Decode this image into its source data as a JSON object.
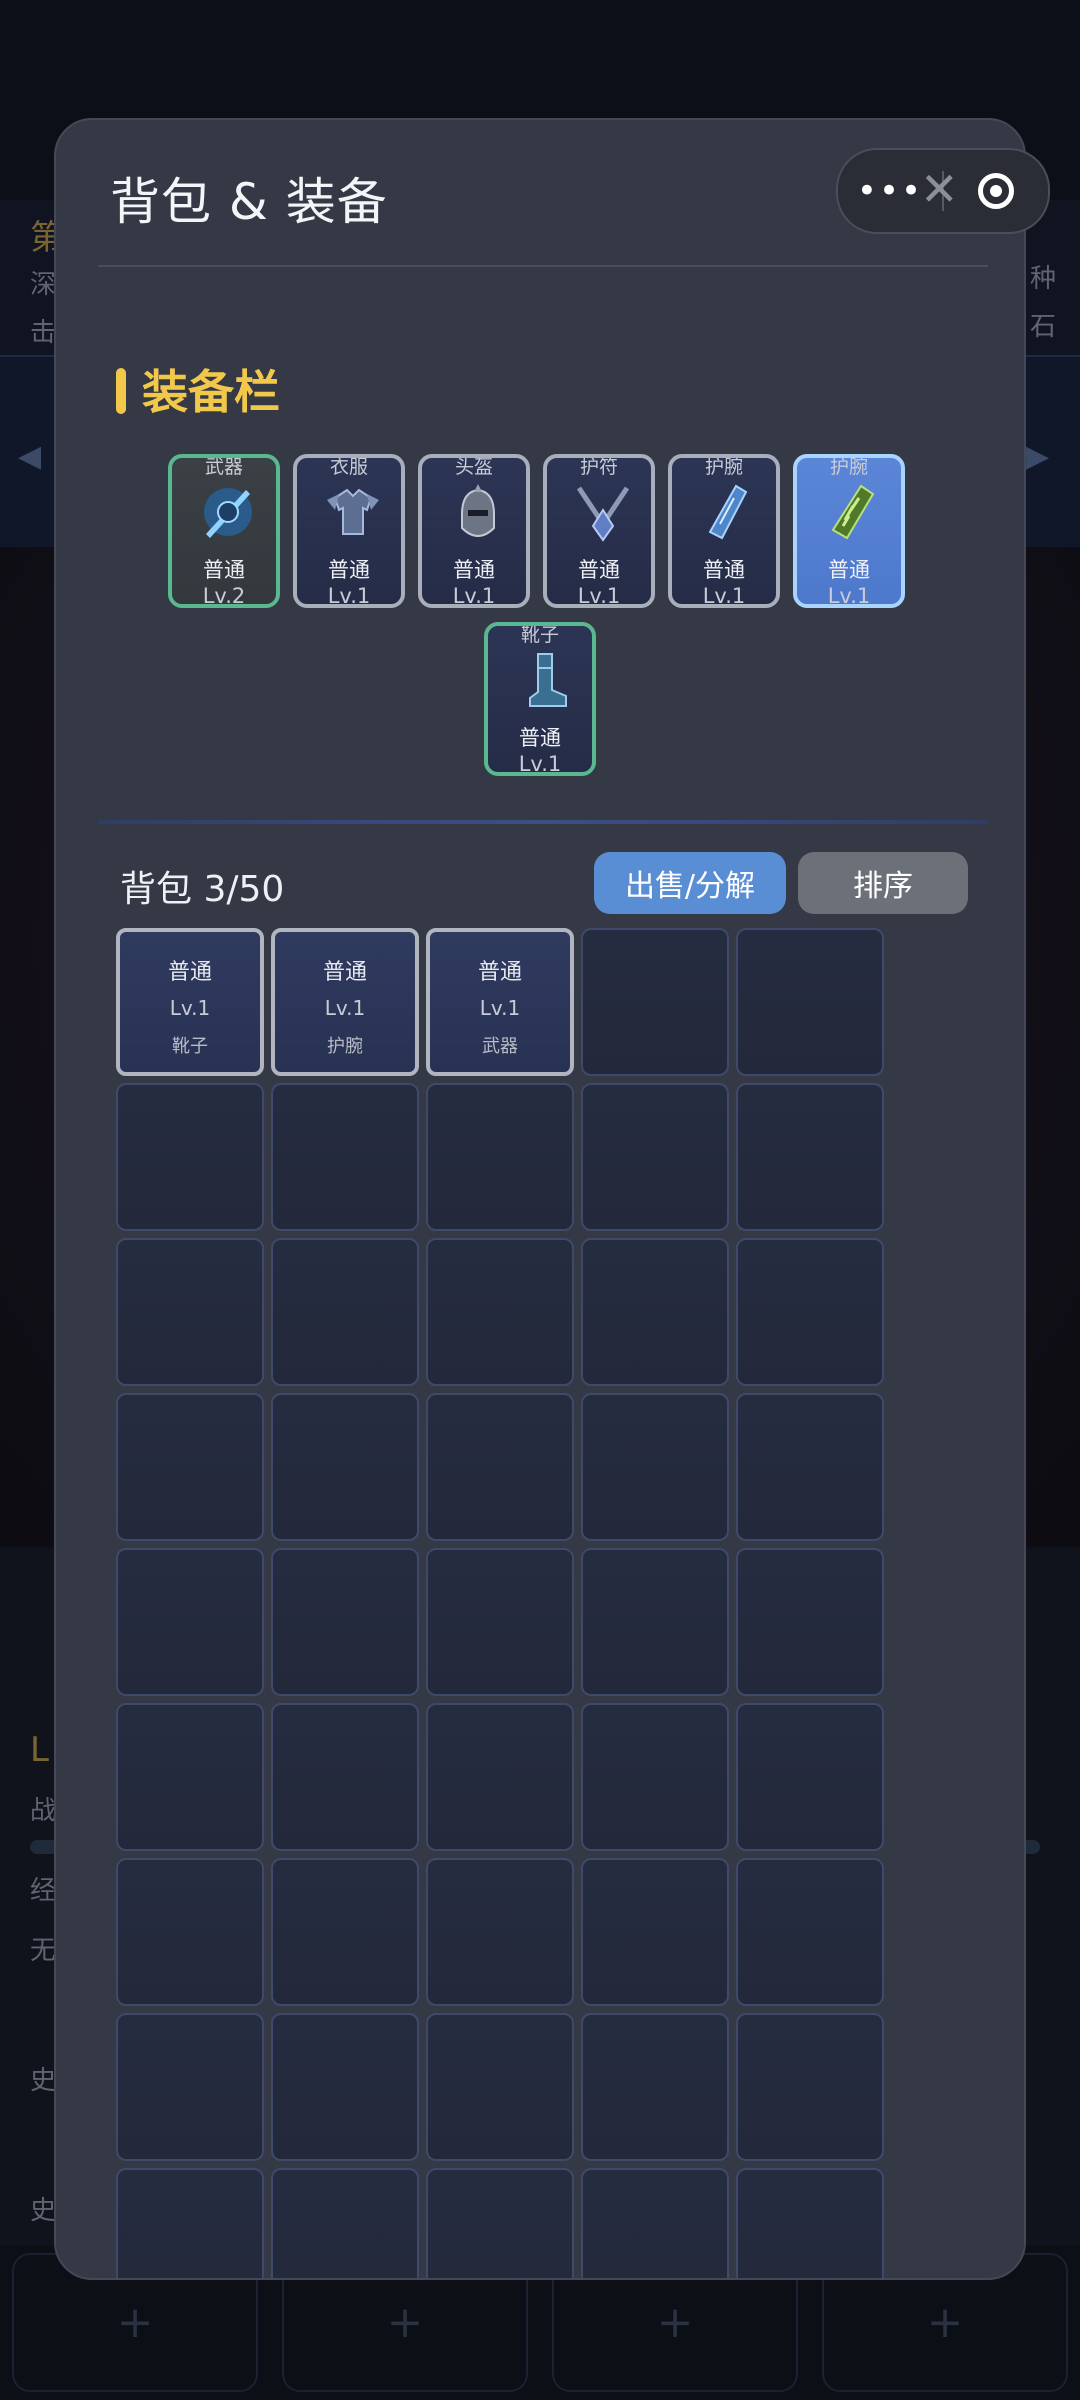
{
  "modal": {
    "title": "背包 & 装备",
    "equip_section_title": "装备栏",
    "equipment": [
      {
        "type": "武器",
        "rarity": "普通",
        "level": "Lv.2",
        "icon": "sword-shield-icon"
      },
      {
        "type": "衣服",
        "rarity": "普通",
        "level": "Lv.1",
        "icon": "armor-icon"
      },
      {
        "type": "头盔",
        "rarity": "普通",
        "level": "Lv.1",
        "icon": "helmet-icon"
      },
      {
        "type": "护符",
        "rarity": "普通",
        "level": "Lv.1",
        "icon": "amulet-icon"
      },
      {
        "type": "护腕",
        "rarity": "普通",
        "level": "Lv.1",
        "icon": "bracer-icon"
      },
      {
        "type": "护腕",
        "rarity": "普通",
        "level": "Lv.1",
        "icon": "green-bracer-icon"
      },
      {
        "type": "靴子",
        "rarity": "普通",
        "level": "Lv.1",
        "icon": "boots-icon"
      }
    ],
    "bag_title": "背包 3/50",
    "sell_button": "出售/分解",
    "sort_button": "排序",
    "bag_items": [
      {
        "rarity": "普通",
        "level": "Lv.1",
        "type": "靴子"
      },
      {
        "rarity": "普通",
        "level": "Lv.1",
        "type": "护腕"
      },
      {
        "rarity": "普通",
        "level": "Lv.1",
        "type": "武器"
      }
    ]
  },
  "capsule": {
    "menu_icon": "more-dots-icon",
    "close_icon": "close-circle-icon"
  },
  "colors": {
    "accent_gold": "#f2c84b",
    "modal_bg": "#353845",
    "sell_button": "#5a8ed4",
    "sort_button": "#6c7079"
  }
}
